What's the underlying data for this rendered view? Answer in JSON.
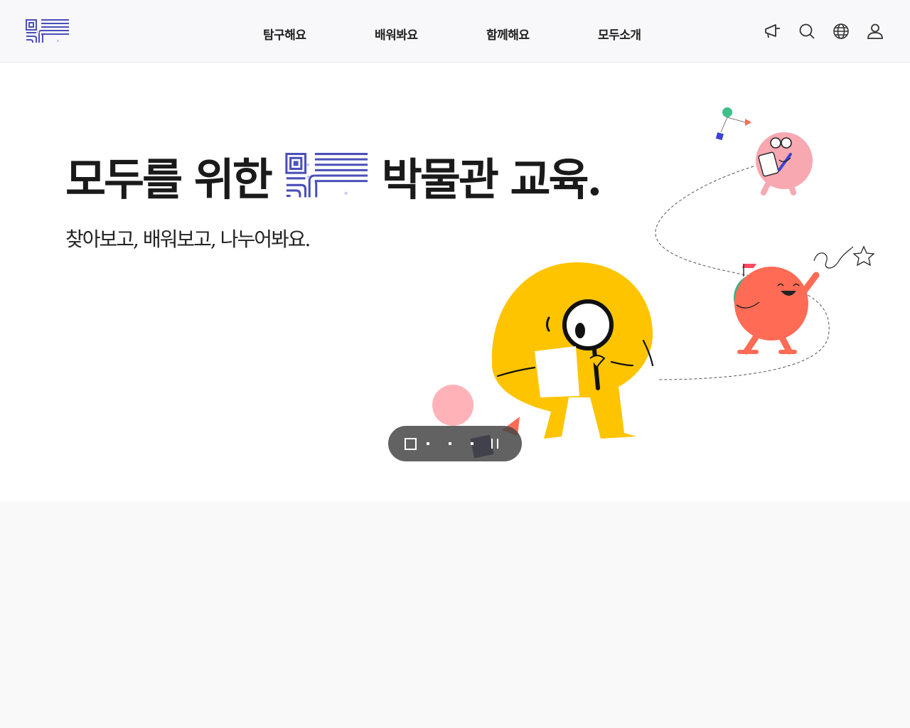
{
  "header": {
    "nav": [
      {
        "label": "탐구해요"
      },
      {
        "label": "배워봐요"
      },
      {
        "label": "함께해요"
      },
      {
        "label": "모두소개"
      }
    ],
    "icons": [
      "megaphone-icon",
      "search-icon",
      "globe-icon",
      "user-icon"
    ]
  },
  "hero": {
    "headline_before": "모두를 위한",
    "headline_after": "박물관 교육.",
    "subline": "찾아보고, 배워보고, 나누어봐요.",
    "slider": {
      "slides": 3,
      "active_slide": 3
    }
  },
  "colors": {
    "brand": "#4b4fb8",
    "brand_light": "#c9c9f2",
    "yellow_character": "#ffc400",
    "red_character": "#ff6b55",
    "pink_character": "#f7a8b0",
    "green_backpack": "#3fae86",
    "navy_shape": "#1f2266"
  }
}
